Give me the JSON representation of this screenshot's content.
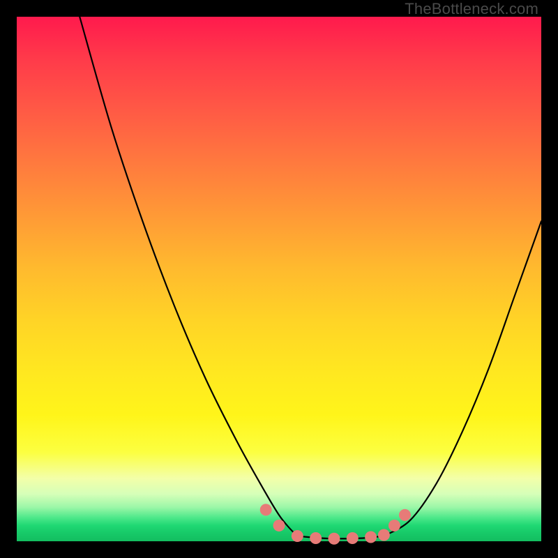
{
  "watermark": "TheBottleneck.com",
  "colors": {
    "frame": "#000000",
    "curve": "#000000",
    "marker_fill": "#e77b78",
    "marker_stroke": "#c96360"
  },
  "chart_data": {
    "type": "line",
    "title": "",
    "xlabel": "",
    "ylabel": "",
    "xlim": [
      0,
      100
    ],
    "ylim": [
      0,
      100
    ],
    "grid": false,
    "legend": false,
    "series": [
      {
        "name": "left-curve",
        "x": [
          12.0,
          18.0,
          24.0,
          30.0,
          36.0,
          42.0,
          47.0,
          50.0,
          52.0,
          53.5
        ],
        "values": [
          100.0,
          79.0,
          61.0,
          45.0,
          31.0,
          19.0,
          10.0,
          5.0,
          2.5,
          1.0
        ]
      },
      {
        "name": "right-curve",
        "x": [
          70.0,
          75.0,
          80.0,
          85.0,
          90.0,
          95.0,
          100.0
        ],
        "values": [
          1.0,
          4.0,
          11.0,
          21.0,
          33.0,
          47.0,
          61.0
        ]
      },
      {
        "name": "flat-valley",
        "x": [
          53.5,
          58.0,
          62.0,
          66.0,
          70.0
        ],
        "values": [
          1.0,
          0.6,
          0.5,
          0.6,
          1.0
        ]
      }
    ],
    "markers": [
      {
        "x": 47.5,
        "y": 6.0
      },
      {
        "x": 50.0,
        "y": 3.0
      },
      {
        "x": 53.5,
        "y": 1.0
      },
      {
        "x": 57.0,
        "y": 0.6
      },
      {
        "x": 60.5,
        "y": 0.5
      },
      {
        "x": 64.0,
        "y": 0.6
      },
      {
        "x": 67.5,
        "y": 0.8
      },
      {
        "x": 70.0,
        "y": 1.2
      },
      {
        "x": 72.0,
        "y": 3.0
      },
      {
        "x": 74.0,
        "y": 5.0
      }
    ]
  }
}
